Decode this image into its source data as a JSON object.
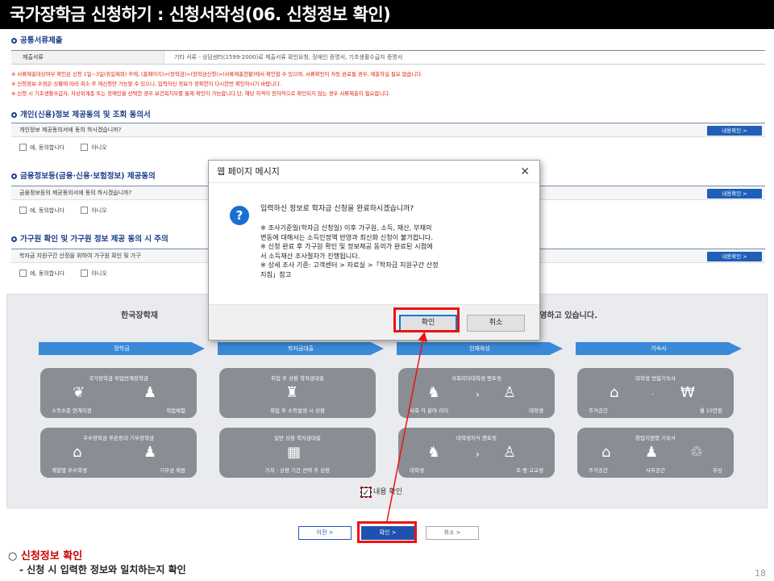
{
  "slide_title": "국가장학금 신청하기 : 신청서작성(06. 신청정보 확인)",
  "docs": {
    "heading": "공통서류제출",
    "label": "제출서류",
    "value": "기타 서류 - 상담센터(1599-2000)로 제출서류 확인요청, 장애인 증명서, 기초생활수급자 증명서"
  },
  "notices": [
    "※ 서류제출대상여부 확인은 신청 1일~3일(휴일제외) 후에, (홈페이지)>(장학금)>(장학금신청)>(서류제출현황)에서 확인할 수 있으며, 서류확인이 자동 완료될 경우, 제출하실 필요 없습니다.",
    "※ 신청정보 수정은 상황에 따라 취소 후 재신청만 가능할 수 있으니, 입력하신 정보가 정확한지 다시한번 확인하시기 바랍니다.",
    "※ 신청 시 기초생활수급자, 차상위계층 또는 장애인을 선택한 경우 보건복지부를 통해 확인이 가능합니다.단, 해당 자격이 전자적으로 확인되지 않는 경우 서류제출이 필요합니다."
  ],
  "sections": [
    {
      "heading": "개인(신용)정보 제공동의 및 조회 동의서",
      "question": "개인정보 제공동의서에 동의 하시겠습니까?",
      "more": "내용확인 >",
      "yes": "예, 동의합니다",
      "no": "아니오"
    },
    {
      "heading": "금융정보등(금융·신용·보험정보) 제공동의",
      "question": "금융정보등의 제공동의서에 동의 하시겠습니까?",
      "more": "내용확인 >",
      "yes": "예, 동의합니다",
      "no": "아니오"
    },
    {
      "heading": "가구원 확인 및 가구원 정보 제공 동의 시 주의",
      "question": "학자금 지원구간 산정을 위하여 가구원 확인 및 가구",
      "more": "내용확인 >",
      "yes": "예, 동의합니다",
      "no": "아니오"
    }
  ],
  "info": {
    "left": "한국장학재",
    "right": "운영하고 있습니다.",
    "right_sub": "."
  },
  "categories": [
    "장학금",
    "학자금대출",
    "인재육성",
    "기숙사"
  ],
  "cards": [
    {
      "title": "국가장학금   취업연계장학금",
      "bl": "소득수준 연계지원",
      "br": "직업체험"
    },
    {
      "title": "취업 후 상환 학자금대출",
      "bc": "취업 후 소득발생 시 상환"
    },
    {
      "title": "사회리더대학생 멘토링",
      "bl": "사회 각 분야 리더",
      "br": "대학생"
    },
    {
      "title": "대학생 연합기숙사",
      "bl": "주거공간",
      "br": "월 15만원"
    },
    {
      "title": "우수장학금   푸른등대 기부장학금",
      "bl": "계열별 우수학생",
      "br": "기부금 재원"
    },
    {
      "title": "일반 상환 학자금대출",
      "bc": "거치 · 상환 기간 선택 후 상환"
    },
    {
      "title": "대학생지식 멘토링",
      "bl": "대학생",
      "br": "초·중·고교생"
    },
    {
      "title": "창업지원형 기숙사",
      "bl": "주거공간",
      "br": "무상",
      "bm": "사무공간"
    }
  ],
  "confirm_label": "내용 확인",
  "nav": {
    "prev": "이전  >",
    "ok": "확인  >",
    "cancel": "취소  >"
  },
  "dialog": {
    "title": "웹 페이지 메시지",
    "close": "✕",
    "question_mark": "?",
    "message": "입력하신 정보로 학자금 신청을 완료하시겠습니까?",
    "details": [
      "※ 조사기준일(학자금 신청일) 이후 가구원, 소득, 재산, 부채의",
      "변동에 대해서는 소득인정액 반영과 최신화 신청이 불가합니다.",
      "※ 신청 완료 후 가구원 확인 및 정보제공 동의가 완료된 시점에",
      "서 소득재산 조사절차가 진행됩니다.",
      "※ 상세 조사 기준: 고객센터 > 자료실 >「학자금 지원구간 산정",
      "지침」참고"
    ],
    "ok": "확인",
    "cancel": "취소"
  },
  "bottom": {
    "bullet": "○",
    "highlight": "신청정보 확인",
    "sub": "- 신청 시 입력한 정보와 일치하는지 확인"
  },
  "page_number": "18",
  "colors": {
    "accent_blue": "#1f52b0",
    "highlight_red": "#e11111",
    "notice_red": "#d21111"
  }
}
